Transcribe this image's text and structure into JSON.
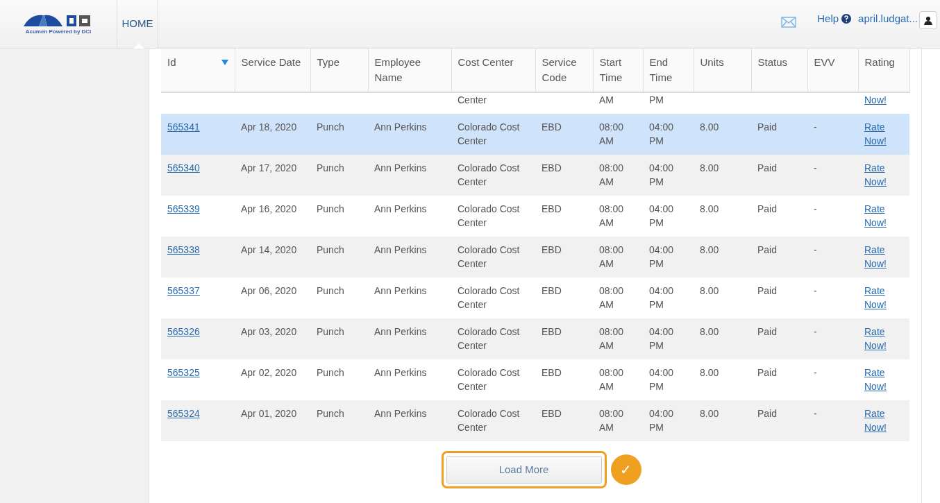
{
  "brand": {
    "tagline": "Acumen Powered by DCI"
  },
  "nav": [
    {
      "label": "HOME",
      "selected": true
    }
  ],
  "header_right": {
    "help": "Help",
    "user": "april.ludgat..."
  },
  "table": {
    "columns": [
      {
        "label": "Id",
        "sorted": true
      },
      {
        "label": "Service Date",
        "sorted": false
      },
      {
        "label": "Type",
        "sorted": false
      },
      {
        "label": "Employee Name",
        "sorted": false
      },
      {
        "label": "Cost Center",
        "sorted": false
      },
      {
        "label": "Service Code",
        "sorted": false
      },
      {
        "label": "Start Time",
        "sorted": false
      },
      {
        "label": "End Time",
        "sorted": false
      },
      {
        "label": "Units",
        "sorted": false
      },
      {
        "label": "Status",
        "sorted": false
      },
      {
        "label": "EVV",
        "sorted": false
      },
      {
        "label": "Rating",
        "sorted": false
      }
    ],
    "partial_row": {
      "cost_center": "Center",
      "start_time": "AM",
      "end_time": "PM",
      "rating": "Now!"
    },
    "rows": [
      {
        "id": "565341",
        "service_date": "Apr 18, 2020",
        "type": "Punch",
        "employee": "Ann Perkins",
        "cost_center": "Colorado Cost Center",
        "service_code": "EBD",
        "start_time": "08:00 AM",
        "end_time": "04:00 PM",
        "units": "8.00",
        "status": "Paid",
        "evv": "-",
        "rating": "Rate Now!",
        "selected": true
      },
      {
        "id": "565340",
        "service_date": "Apr 17, 2020",
        "type": "Punch",
        "employee": "Ann Perkins",
        "cost_center": "Colorado Cost Center",
        "service_code": "EBD",
        "start_time": "08:00 AM",
        "end_time": "04:00 PM",
        "units": "8.00",
        "status": "Paid",
        "evv": "-",
        "rating": "Rate Now!",
        "selected": false
      },
      {
        "id": "565339",
        "service_date": "Apr 16, 2020",
        "type": "Punch",
        "employee": "Ann Perkins",
        "cost_center": "Colorado Cost Center",
        "service_code": "EBD",
        "start_time": "08:00 AM",
        "end_time": "04:00 PM",
        "units": "8.00",
        "status": "Paid",
        "evv": "-",
        "rating": "Rate Now!",
        "selected": false
      },
      {
        "id": "565338",
        "service_date": "Apr 14, 2020",
        "type": "Punch",
        "employee": "Ann Perkins",
        "cost_center": "Colorado Cost Center",
        "service_code": "EBD",
        "start_time": "08:00 AM",
        "end_time": "04:00 PM",
        "units": "8.00",
        "status": "Paid",
        "evv": "-",
        "rating": "Rate Now!",
        "selected": false
      },
      {
        "id": "565337",
        "service_date": "Apr 06, 2020",
        "type": "Punch",
        "employee": "Ann Perkins",
        "cost_center": "Colorado Cost Center",
        "service_code": "EBD",
        "start_time": "08:00 AM",
        "end_time": "04:00 PM",
        "units": "8.00",
        "status": "Paid",
        "evv": "-",
        "rating": "Rate Now!",
        "selected": false
      },
      {
        "id": "565326",
        "service_date": "Apr 03, 2020",
        "type": "Punch",
        "employee": "Ann Perkins",
        "cost_center": "Colorado Cost Center",
        "service_code": "EBD",
        "start_time": "08:00 AM",
        "end_time": "04:00 PM",
        "units": "8.00",
        "status": "Paid",
        "evv": "-",
        "rating": "Rate Now!",
        "selected": false
      },
      {
        "id": "565325",
        "service_date": "Apr 02, 2020",
        "type": "Punch",
        "employee": "Ann Perkins",
        "cost_center": "Colorado Cost Center",
        "service_code": "EBD",
        "start_time": "08:00 AM",
        "end_time": "04:00 PM",
        "units": "8.00",
        "status": "Paid",
        "evv": "-",
        "rating": "Rate Now!",
        "selected": false
      },
      {
        "id": "565324",
        "service_date": "Apr 01, 2020",
        "type": "Punch",
        "employee": "Ann Perkins",
        "cost_center": "Colorado Cost Center",
        "service_code": "EBD",
        "start_time": "08:00 AM",
        "end_time": "04:00 PM",
        "units": "8.00",
        "status": "Paid",
        "evv": "-",
        "rating": "Rate Now!",
        "selected": false
      }
    ]
  },
  "load_more": {
    "label": "Load More",
    "highlighted": true,
    "check": "✓"
  }
}
